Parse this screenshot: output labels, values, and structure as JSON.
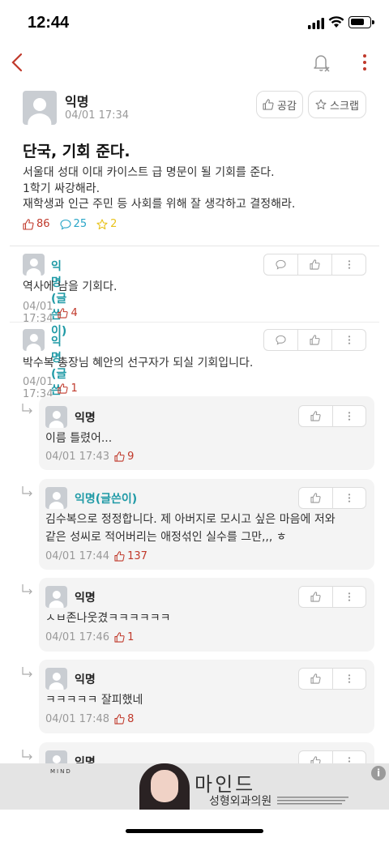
{
  "status": {
    "time": "12:44"
  },
  "post": {
    "author": "익명",
    "time": "04/01 17:34",
    "like_label": "공감",
    "scrap_label": "스크랩",
    "title": "단국, 기회 준다.",
    "body": [
      "서울대 성대 이대 카이스트 급 명문이 될 기회를 준다.",
      "1학기 싸강해라.",
      "재학생과 인근 주민 등 사회를 위해 잘 생각하고 결정해라."
    ],
    "likes": "86",
    "comments": "25",
    "scraps": "2"
  },
  "comments": [
    {
      "author": "익명(글쓴이)",
      "text": "역사에 남을 기회다.",
      "time": "04/01 17:34",
      "likes": "4"
    },
    {
      "author": "익명(글쓴이)",
      "text": "박수복 총장님 혜안의 선구자가 되실 기회입니다.",
      "time": "04/01 17:34",
      "likes": "1"
    }
  ],
  "replies": [
    {
      "author": "익명",
      "lines": [
        "이름 틀렸어..."
      ],
      "time": "04/01 17:43",
      "likes": "9"
    },
    {
      "author": "익명(글쓴이)",
      "lines": [
        "김수복으로 정정합니다. 제 아버지로 모시고 싶은 마음에 저와",
        "같은 성씨로 적어버리는 애정섞인 실수를 그만,,, ㅎ"
      ],
      "time": "04/01 17:44",
      "likes": "137"
    },
    {
      "author": "익명",
      "lines": [
        "ㅅㅂ존나웃겼ㅋㅋㅋㅋㅋㅋ"
      ],
      "time": "04/01 17:46",
      "likes": "1"
    },
    {
      "author": "익명",
      "lines": [
        "ㅋㅋㅋㅋㅋ 잘피했네"
      ],
      "time": "04/01 17:48",
      "likes": "8"
    },
    {
      "author": "익명",
      "lines": [],
      "time": "",
      "likes": ""
    }
  ],
  "ad": {
    "logo": "MIND",
    "title": "마인드",
    "subtitle": "성형외과의원",
    "info": "i"
  },
  "colors": {
    "back": "#c0392b",
    "op_author": "#1f9aa6",
    "like": "#c0392b",
    "comment_count": "#2aa6c8",
    "scrap_count": "#e8c21c"
  }
}
